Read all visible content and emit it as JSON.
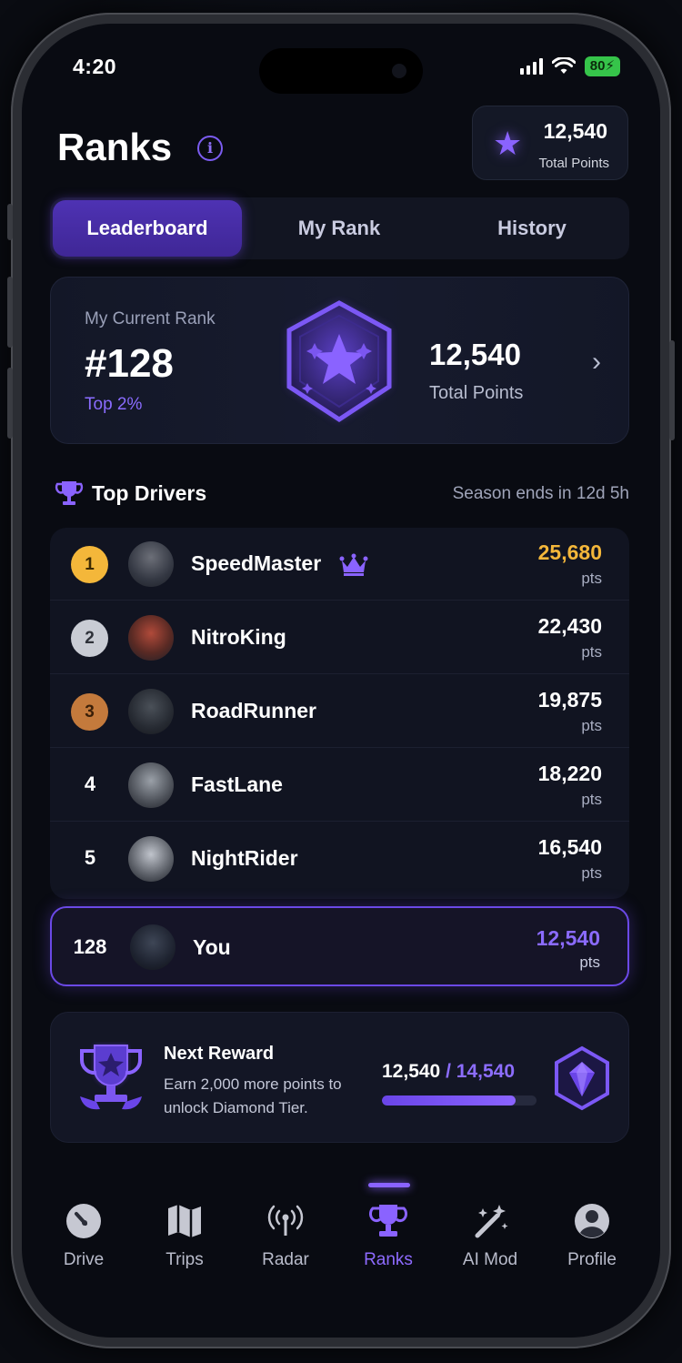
{
  "status_bar": {
    "time": "4:20",
    "battery": "80"
  },
  "header": {
    "title": "Ranks",
    "info_glyph": "i",
    "points_value": "12,540",
    "points_label": "Total Points"
  },
  "tabs": [
    {
      "label": "Leaderboard",
      "active": true
    },
    {
      "label": "My Rank",
      "active": false
    },
    {
      "label": "History",
      "active": false
    }
  ],
  "current_rank": {
    "label": "My Current Rank",
    "rank": "#128",
    "percentile": "Top 2%",
    "points": "12,540",
    "points_label": "Total Points"
  },
  "top_drivers": {
    "title": "Top Drivers",
    "season_note": "Season ends in 12d 5h",
    "unit": "pts",
    "rows": [
      {
        "position": "1",
        "name": "SpeedMaster",
        "score": "25,680",
        "medal": "gold",
        "crown": true
      },
      {
        "position": "2",
        "name": "NitroKing",
        "score": "22,430",
        "medal": "silver"
      },
      {
        "position": "3",
        "name": "RoadRunner",
        "score": "19,875",
        "medal": "bronze"
      },
      {
        "position": "4",
        "name": "FastLane",
        "score": "18,220"
      },
      {
        "position": "5",
        "name": "NightRider",
        "score": "16,540"
      }
    ],
    "you": {
      "position": "128",
      "name": "You",
      "score": "12,540"
    }
  },
  "next_reward": {
    "title": "Next Reward",
    "description": "Earn 2,000 more points to unlock Diamond Tier.",
    "current": "12,540",
    "separator": "/",
    "goal": "14,540",
    "progress_fraction": 0.862
  },
  "nav": [
    {
      "label": "Drive",
      "icon": "speedometer-icon"
    },
    {
      "label": "Trips",
      "icon": "map-icon"
    },
    {
      "label": "Radar",
      "icon": "radar-antenna-icon"
    },
    {
      "label": "Ranks",
      "icon": "trophy-icon",
      "active": true
    },
    {
      "label": "AI Mod",
      "icon": "magic-wand-icon"
    },
    {
      "label": "Profile",
      "icon": "user-icon"
    }
  ],
  "colors": {
    "accent": "#8a63ff",
    "gold": "#f4b73a",
    "silver": "#c9ccd4",
    "bronze": "#c47a3c",
    "battery": "#36c44a"
  }
}
